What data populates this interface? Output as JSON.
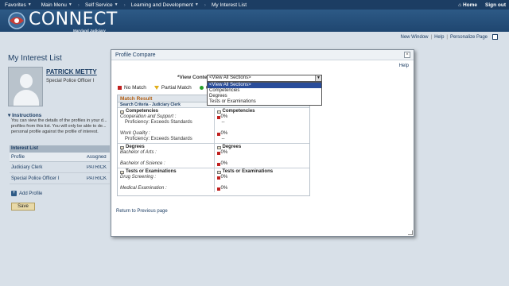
{
  "nav": {
    "favorites": "Favorites",
    "main_menu": "Main Menu",
    "self_service": "Self Service",
    "learning": "Learning and Development",
    "current": "My Interest List",
    "home": "Home",
    "signout": "Sign out"
  },
  "brand": {
    "name": "CONNECT",
    "sub": "Maryland Judiciary"
  },
  "toplinks": {
    "new_window": "New Window",
    "help": "Help",
    "personalize": "Personalize Page"
  },
  "page": {
    "title": "My Interest List",
    "person_name": "PATRICK METTY",
    "person_title": "Special Police Officer I",
    "instructions_label": "Instructions",
    "instructions_text": "You can view the details of the profiles in your d... profiles from this list. You will only be able to de... personal profile against the profile of interest.",
    "list_header": "Interest List",
    "col_profile": "Profile",
    "col_assigned": "Assigned",
    "rows": [
      {
        "profile": "Judiciary Clerk",
        "assigned": "PATRICK"
      },
      {
        "profile": "Special Police Officer I",
        "assigned": "PATRICK"
      }
    ],
    "add_profile": "Add Profile",
    "save": "Save"
  },
  "modal": {
    "title": "Profile Compare",
    "close": "×",
    "help": "Help",
    "view_label": "*View Content Section",
    "selected": "<View All Sections>",
    "options": [
      "<View All Sections>",
      "Competencies",
      "Degrees",
      "Tests or Examinations"
    ],
    "legend": {
      "no_match": "No Match",
      "partial": "Partial Match",
      "co": "Co"
    },
    "match_result": "Match Result",
    "criteria_left": "Search Criteria - Judiciary Clerk",
    "criteria_right": "PATRICK METTY: 0%",
    "competencies": "Competencies",
    "comp_item1": "Cooperation and Support :",
    "comp_item2": "Work Quality :",
    "proficiency": "Proficiency: Exceeds Standards",
    "degrees": "Degrees",
    "deg1": "Bachelor of Arts :",
    "deg2": "Bachelor of Science :",
    "tests": "Tests or Examinations",
    "test1": "Drug Screening :",
    "test2": "Medical Examination :",
    "pct": "0%",
    "dash": "--",
    "back": "Return to Previous page"
  },
  "colors": {
    "nav": "#1c3d63",
    "no_match": "#c0201f",
    "partial": "#e1ae19",
    "match": "#27a02a"
  }
}
